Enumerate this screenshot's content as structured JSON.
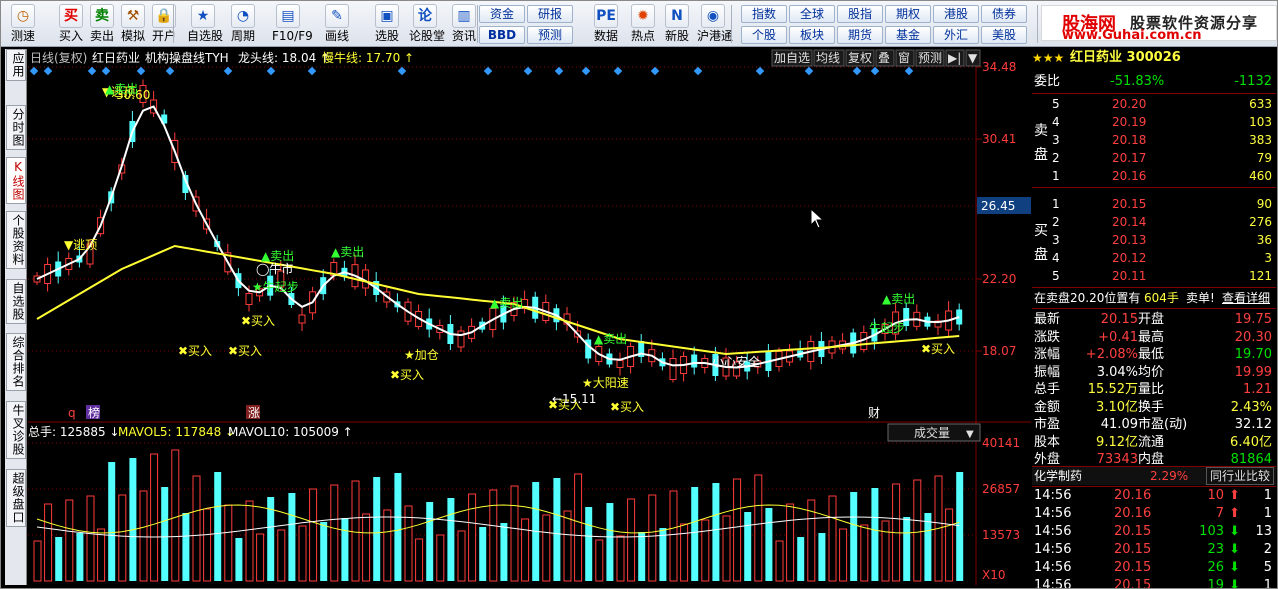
{
  "toolbar": {
    "buttons": [
      {
        "label": "测速",
        "icon": "clock-icon",
        "glyph": "◷",
        "color": "#c06000"
      },
      {
        "label": "买入",
        "icon": "buy-icon",
        "glyph": "买",
        "color": "#e00000"
      },
      {
        "label": "卖出",
        "icon": "sell-icon",
        "glyph": "卖",
        "color": "#008000"
      },
      {
        "label": "模拟",
        "icon": "hammer-icon",
        "glyph": "⚒",
        "color": "#a05000"
      },
      {
        "label": "开户",
        "icon": "lock-icon",
        "glyph": "🔒",
        "color": "#806000"
      },
      {
        "label": "自选股",
        "icon": "star-icon",
        "glyph": "★",
        "color": "#1050c0"
      },
      {
        "label": "周期",
        "icon": "period-icon",
        "glyph": "◔",
        "color": "#1050c0"
      },
      {
        "label": "F10/F9",
        "icon": "f10-icon",
        "glyph": "▤",
        "color": "#1050c0"
      },
      {
        "label": "画线",
        "icon": "pen-icon",
        "glyph": "✎",
        "color": "#1050c0"
      },
      {
        "label": "选股",
        "icon": "select-icon",
        "glyph": "▣",
        "color": "#1050c0"
      },
      {
        "label": "论股堂",
        "icon": "forum-icon",
        "glyph": "论",
        "color": "#1050c0"
      },
      {
        "label": "资讯",
        "icon": "news-icon",
        "glyph": "▥",
        "color": "#1050c0"
      },
      {
        "label": "数据",
        "icon": "pe-icon",
        "glyph": "PE",
        "color": "#1050c0"
      },
      {
        "label": "热点",
        "icon": "fire-icon",
        "glyph": "✹",
        "color": "#e04000"
      },
      {
        "label": "新股",
        "icon": "newstock-icon",
        "glyph": "N",
        "color": "#1050c0"
      },
      {
        "label": "沪港通",
        "icon": "hk-connect-icon",
        "glyph": "◉",
        "color": "#1050c0"
      }
    ],
    "small_buttons": [
      "资金",
      "研报",
      "BBD",
      "预测",
      "指数",
      "全球",
      "股指",
      "期权",
      "港股",
      "债券",
      "个股",
      "板块",
      "期货",
      "基金",
      "外汇",
      "美股"
    ],
    "logo": {
      "title": "股海网",
      "subtitle": "股票软件资源分享",
      "url": "www.Guhai.com.cn"
    }
  },
  "left_tabs": [
    {
      "label": "应用",
      "active": false
    },
    {
      "label": "分时图",
      "active": false
    },
    {
      "label": "K线图",
      "active": true
    },
    {
      "label": "个股资料",
      "active": false
    },
    {
      "label": "自选股",
      "active": false
    },
    {
      "label": "综合排名",
      "active": false
    },
    {
      "label": "牛叉诊股",
      "active": false
    },
    {
      "label": "超级盘口",
      "active": false
    }
  ],
  "chart": {
    "header": {
      "period": "日线(复权)",
      "stock": "红日药业",
      "indicator": "机构操盘线TYH",
      "long_label": "龙头线:",
      "long_value": "18.04",
      "slow_label": "慢牛线:",
      "slow_value": "17.70"
    },
    "header_buttons": [
      "加自选",
      "均线",
      "复权",
      "叠",
      "窗",
      "预测",
      "▶|",
      "▼"
    ],
    "y_labels": [
      "34.48",
      "30.41",
      "26.45",
      "22.20",
      "18.07"
    ],
    "current_price_label": "26.45",
    "annotations": {
      "sell_top": "逃顶",
      "sell": "卖出",
      "buy": "买入",
      "add": "加仓",
      "cow": "牛起步",
      "cow2": "牛市",
      "big": "大阳速",
      "caution": "小心安全",
      "low": "15.11",
      "high": "30.60"
    },
    "event_marks": [
      "q",
      "榜",
      "涨",
      "财"
    ],
    "volume_header": {
      "total_label": "总手:",
      "total": "125885",
      "mav5_label": "MAVOL5:",
      "mav5": "117848",
      "mav10_label": "MAVOL10:",
      "mav10": "105009"
    },
    "volume_dropdown": "成交量",
    "volume_y_labels": [
      "40141",
      "26857",
      "13573"
    ],
    "volume_unit": "X10",
    "colors": {
      "up": "#ff3c3c",
      "down": "#54ffff",
      "ma_white": "#ffffff",
      "ma_yellow": "#ffff33",
      "grid": "#800000"
    }
  },
  "quote": {
    "title": "红日药业 300026",
    "ratio_label": "委比",
    "ratio_pct": "-51.83%",
    "ratio_val": "-1132",
    "sell_label": "卖盘",
    "buy_label": "买盘",
    "asks": [
      {
        "n": "5",
        "price": "20.20",
        "vol": "633"
      },
      {
        "n": "4",
        "price": "20.19",
        "vol": "103"
      },
      {
        "n": "3",
        "price": "20.18",
        "vol": "383"
      },
      {
        "n": "2",
        "price": "20.17",
        "vol": "79"
      },
      {
        "n": "1",
        "price": "20.16",
        "vol": "460"
      }
    ],
    "bids": [
      {
        "n": "1",
        "price": "20.15",
        "vol": "90"
      },
      {
        "n": "2",
        "price": "20.14",
        "vol": "276"
      },
      {
        "n": "3",
        "price": "20.13",
        "vol": "36"
      },
      {
        "n": "4",
        "price": "20.12",
        "vol": "3"
      },
      {
        "n": "5",
        "price": "20.11",
        "vol": "121"
      }
    ],
    "note": {
      "text": "在卖盘20.20位置有",
      "qty": "604手",
      "action": "卖单!",
      "link": "查看详细"
    },
    "stats": [
      {
        "l1": "最新",
        "v1": "20.15",
        "c1": "#ff4040",
        "l2": "开盘",
        "v2": "19.75",
        "c2": "#ff4040"
      },
      {
        "l1": "涨跌",
        "v1": "+0.41",
        "c1": "#ff4040",
        "l2": "最高",
        "v2": "20.30",
        "c2": "#ff4040"
      },
      {
        "l1": "涨幅",
        "v1": "+2.08%",
        "c1": "#ff4040",
        "l2": "最低",
        "v2": "19.70",
        "c2": "#00e000"
      },
      {
        "l1": "振幅",
        "v1": "3.04%",
        "c1": "#ffffff",
        "l2": "均价",
        "v2": "19.99",
        "c2": "#ff4040"
      },
      {
        "l1": "总手",
        "v1": "15.52万",
        "c1": "#ffff40",
        "l2": "量比",
        "v2": "1.21",
        "c2": "#ff4040"
      },
      {
        "l1": "金额",
        "v1": "3.10亿",
        "c1": "#ffff40",
        "l2": "换手",
        "v2": "2.43%",
        "c2": "#ffff40"
      },
      {
        "l1": "市盈",
        "v1": "41.09",
        "c1": "#ffffff",
        "l2": "市盈(动)",
        "v2": "32.12",
        "c2": "#ffffff"
      },
      {
        "l1": "股本",
        "v1": "9.12亿",
        "c1": "#ffff40",
        "l2": "流通",
        "v2": "6.40亿",
        "c2": "#ffff40"
      },
      {
        "l1": "外盘",
        "v1": "73343",
        "c1": "#ff4040",
        "l2": "内盘",
        "v2": "81864",
        "c2": "#00e000"
      }
    ],
    "sector": {
      "name": "化学制药",
      "pct": "2.29%",
      "compare": "同行业比较"
    },
    "ticks": [
      {
        "t": "14:56",
        "p": "20.16",
        "v": "10",
        "dir": "up",
        "n": "1"
      },
      {
        "t": "14:56",
        "p": "20.16",
        "v": "7",
        "dir": "up",
        "n": "1"
      },
      {
        "t": "14:56",
        "p": "20.15",
        "v": "103",
        "dir": "down",
        "n": "13"
      },
      {
        "t": "14:56",
        "p": "20.15",
        "v": "23",
        "dir": "down",
        "n": "2"
      },
      {
        "t": "14:56",
        "p": "20.15",
        "v": "26",
        "dir": "down",
        "n": "5"
      },
      {
        "t": "14:56",
        "p": "20.15",
        "v": "19",
        "dir": "down",
        "n": "1"
      }
    ]
  }
}
